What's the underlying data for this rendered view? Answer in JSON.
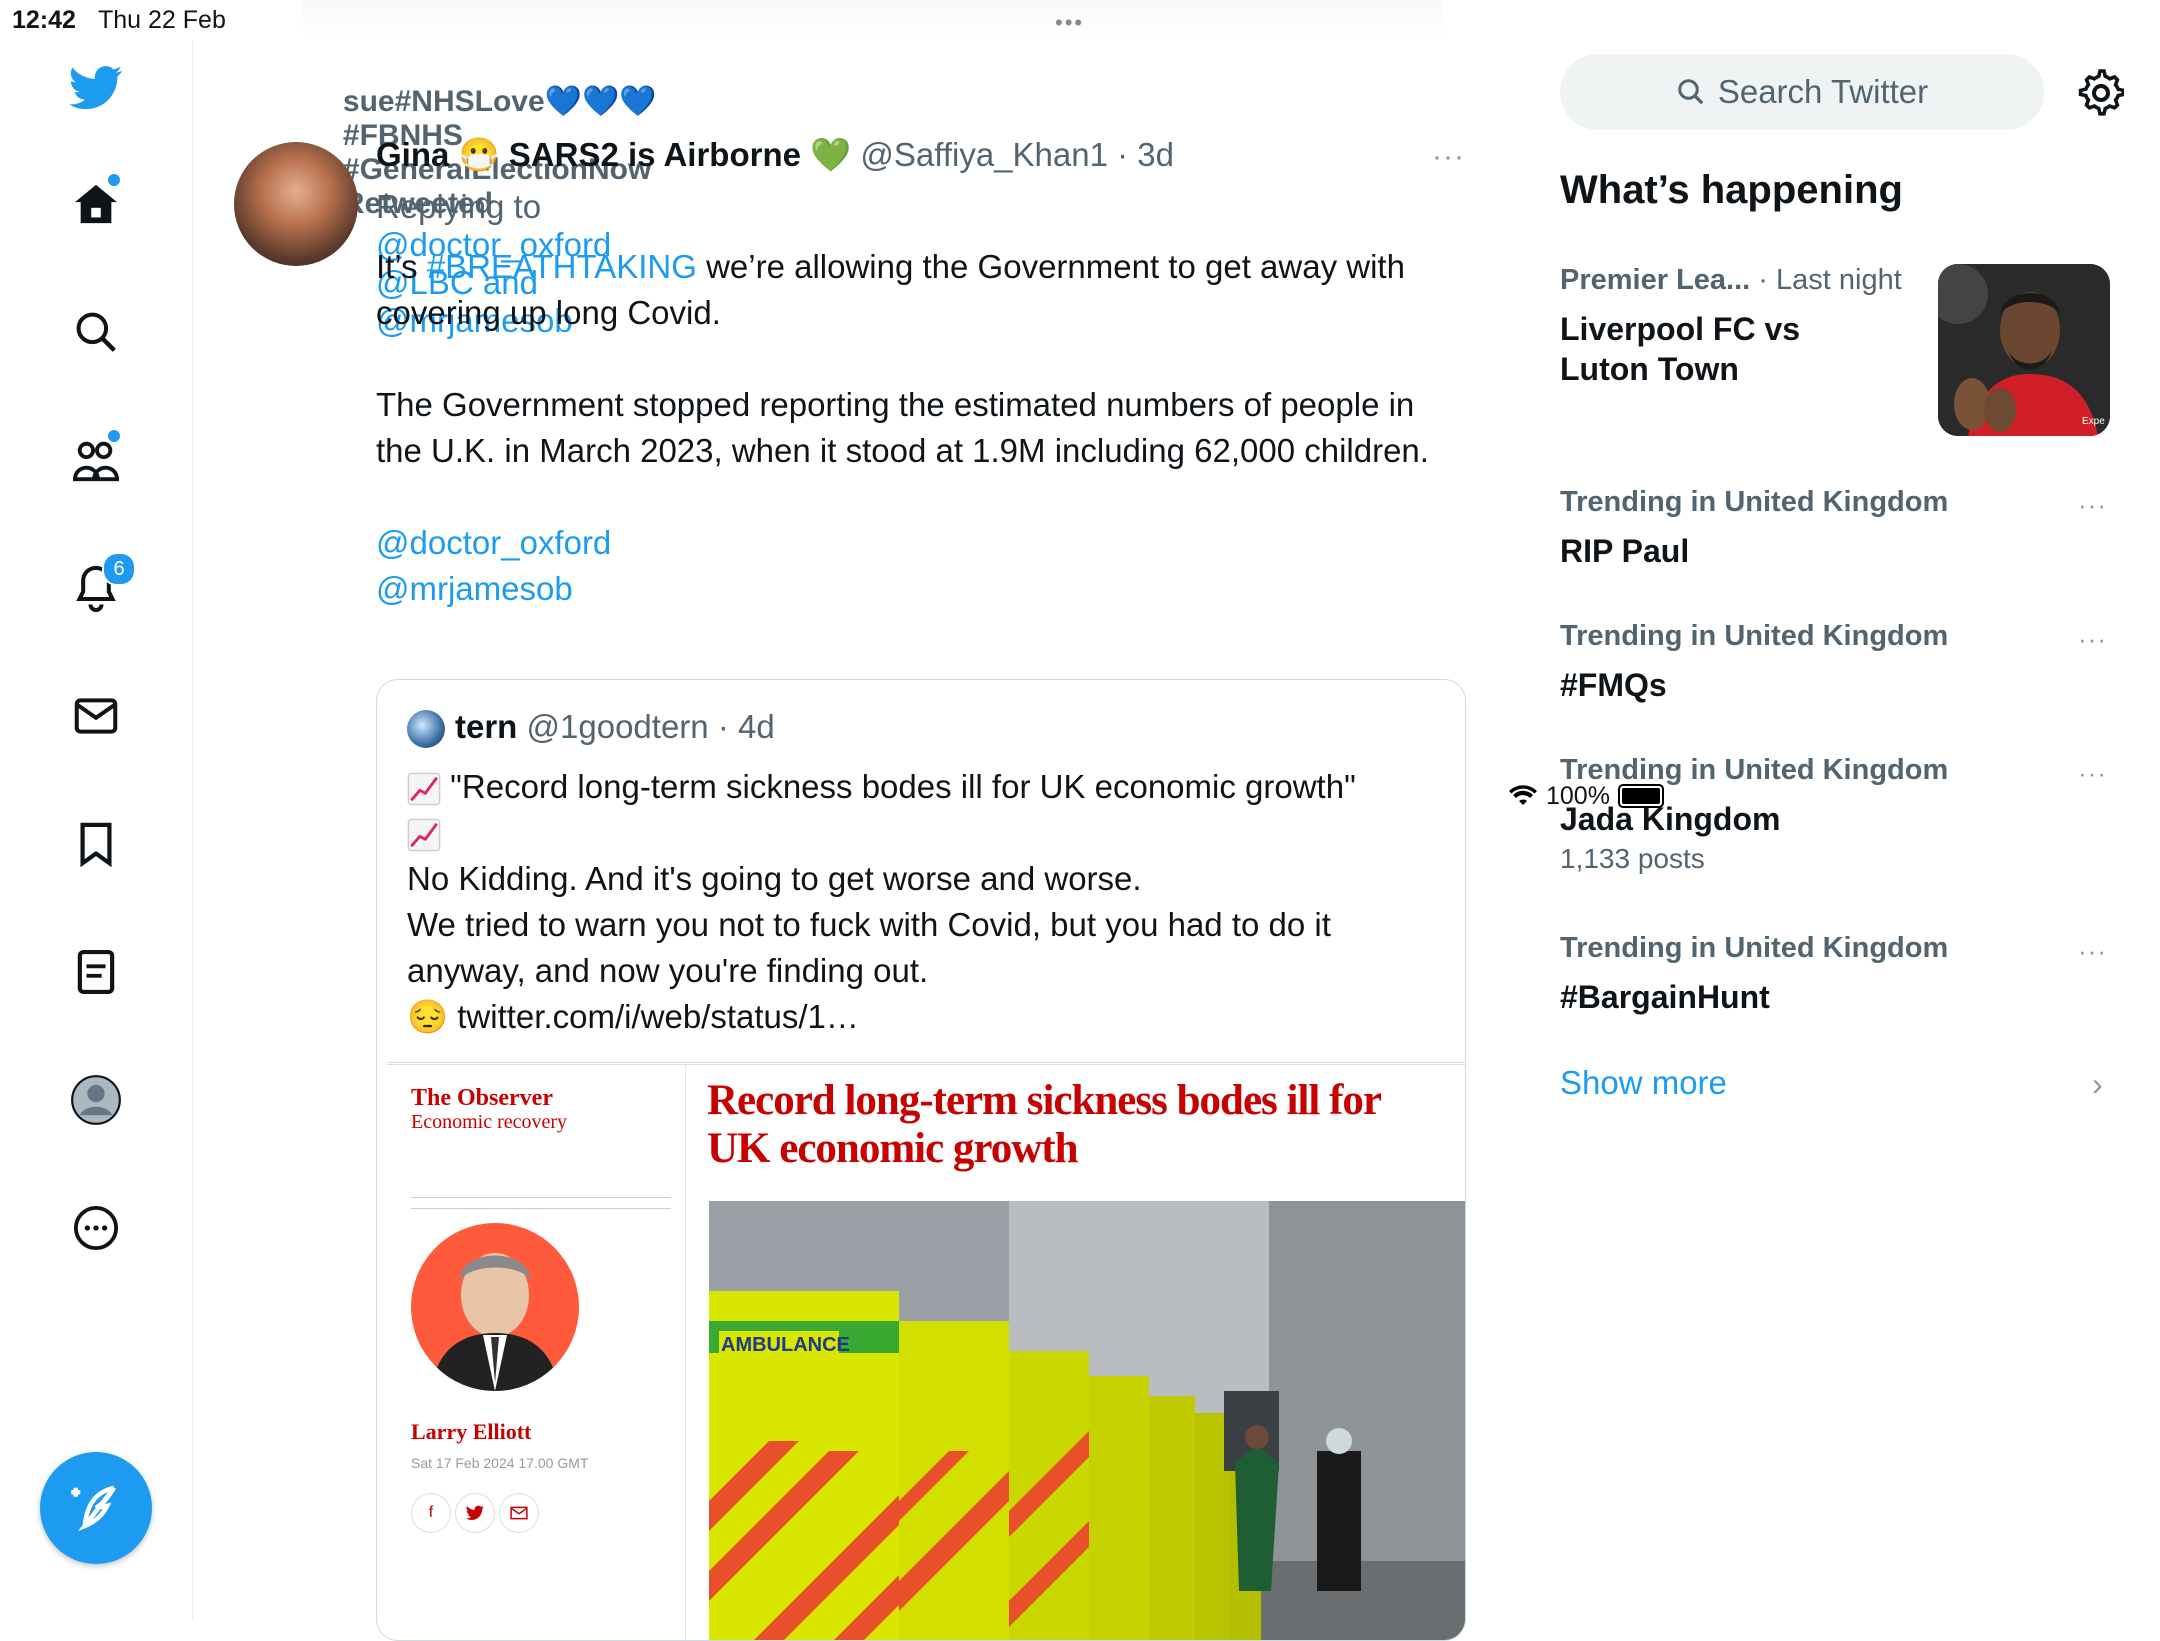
{
  "status_bar": {
    "time": "12:42",
    "date": "Thu 22 Feb",
    "battery": "100%",
    "grabber": "•••"
  },
  "sidebar": {
    "items": [
      {
        "name": "twitter-logo-icon"
      },
      {
        "name": "home-icon",
        "dot": true
      },
      {
        "name": "search-icon"
      },
      {
        "name": "communities-icon",
        "dot": true
      },
      {
        "name": "notifications-icon",
        "badge": "6"
      },
      {
        "name": "messages-icon"
      },
      {
        "name": "bookmarks-icon"
      },
      {
        "name": "lists-icon"
      },
      {
        "name": "profile-icon"
      },
      {
        "name": "more-icon"
      }
    ],
    "compose": "compose-tweet-icon"
  },
  "tweet": {
    "retweeted_by": "sue#NHSLove💙💙💙#FBNHS #GeneralElectionNow Retweeted",
    "author_name": "Gina 😷 SARS2 is Airborne 💚",
    "handle": "@Saffiya_Khan1",
    "time": "· 3d",
    "more": "···",
    "replying_prefix": "Replying to ",
    "replying_to": "@doctor_oxford @LBC and @mrjamesob",
    "text_1_pre": "It’s ",
    "text_1_hashtag": "#BREATHTAKING",
    "text_1_post": " we’re allowing the Government to get away with covering up long Covid.",
    "text_2": "The Government stopped reporting the estimated numbers of people in the U.K. in March 2023, when it stood at 1.9M including 62,000 children.",
    "mention_1": "@doctor_oxford",
    "mention_2": "@mrjamesob"
  },
  "quote": {
    "author_name": "tern",
    "handle": "@1goodtern",
    "time": "· 4d",
    "line_1": "\"Record long-term sickness bodes ill for UK economic growth\"",
    "line_2": "No Kidding. And it's going to get worse and worse.",
    "line_3": "We tried to warn you not to fuck with Covid, but you had to do it anyway, and now you're finding out.",
    "link": "twitter.com/i/web/status/1…"
  },
  "article": {
    "publication": "The Observer",
    "section": "Economic recovery",
    "author": "Larry Elliott",
    "date": "Sat 17 Feb 2024 17.00 GMT",
    "headline": "Record long-term sickness bodes ill for UK economic growth",
    "photo_text": "AMBULANCE"
  },
  "right_panel": {
    "search_placeholder": "Search Twitter",
    "heading": "What’s happening",
    "trends": [
      {
        "meta": "Premier Lea...",
        "time": "· Last night",
        "topic_line_1": "Liverpool FC vs",
        "topic_line_2": "Luton Town"
      },
      {
        "meta": "Trending in United Kingdom",
        "topic": "RIP Paul"
      },
      {
        "meta": "Trending in United Kingdom",
        "topic": "#FMQs"
      },
      {
        "meta": "Trending in United Kingdom",
        "topic": "Jada Kingdom",
        "posts": "1,133 posts"
      },
      {
        "meta": "Trending in United Kingdom",
        "topic": "#BargainHunt"
      }
    ],
    "more_dots": "···",
    "show_more": "Show more",
    "chevron": "›"
  },
  "colors": {
    "accent": "#1d9bf0",
    "text": "#0f1419",
    "secondary": "#536471",
    "observer_red": "#c70000"
  }
}
